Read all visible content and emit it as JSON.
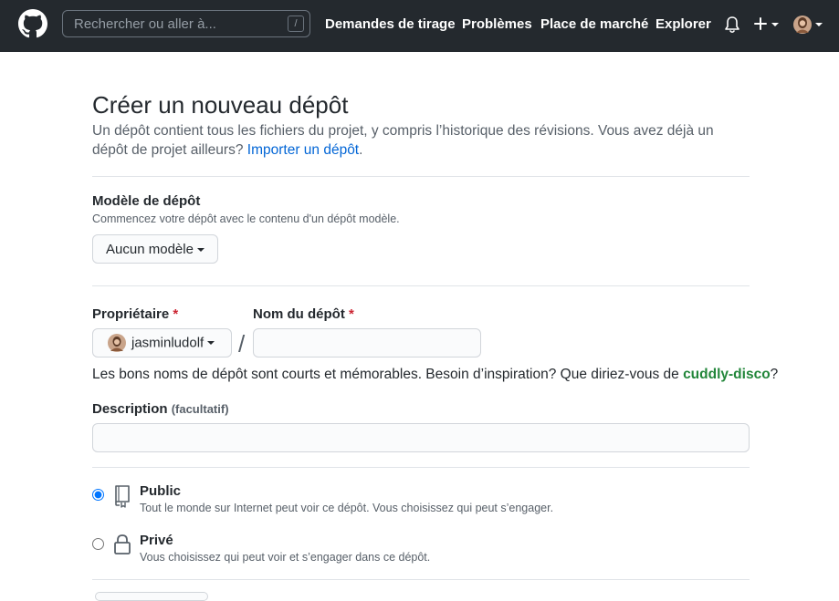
{
  "header": {
    "search_placeholder": "Rechercher ou aller à...",
    "search_key": "/",
    "nav": [
      "Demandes de tirage",
      "Problèmes",
      "Place de marché",
      "Explorer"
    ],
    "colors": {
      "background": "#24292e",
      "text": "#ffffff"
    }
  },
  "page": {
    "title": "Créer un nouveau dépôt",
    "subtitle": "Un dépôt contient tous les fichiers du projet, y compris l’historique des révisions. Vous avez déjà un dépôt de projet ailleurs?",
    "import_link": "Importer un dépôt",
    "import_suffix": "."
  },
  "template": {
    "title": "Modèle de dépôt",
    "desc": "Commencez votre dépôt avec le contenu d'un dépôt modèle.",
    "button": "Aucun modèle"
  },
  "owner": {
    "label": "Propriétaire",
    "required_mark": "*",
    "value": "jasminludolf"
  },
  "repo_name": {
    "label": "Nom du dépôt",
    "required_mark": "*",
    "separator": "/",
    "value": ""
  },
  "hint": {
    "text": "Les bons noms de dépôt sont courts et mémorables. Besoin d’inspiration? Que diriez-vous de ",
    "suggestion": "cuddly-disco",
    "suffix": "?"
  },
  "description": {
    "label": "Description",
    "optional": "(facultatif)",
    "value": ""
  },
  "visibility": {
    "public": {
      "title": "Public",
      "desc": "Tout le monde sur Internet peut voir ce dépôt. Vous choisissez qui peut s’engager.",
      "checked": true,
      "icon": "repo-icon"
    },
    "private": {
      "title": "Privé",
      "desc": "Vous choisissez qui peut voir et s’engager dans ce dépôt.",
      "checked": false,
      "icon": "lock-icon"
    }
  },
  "colors": {
    "link": "#0366d6",
    "suggestion": "#22863a",
    "required": "#cb2431",
    "muted": "#586069",
    "border": "#e1e4e8"
  }
}
